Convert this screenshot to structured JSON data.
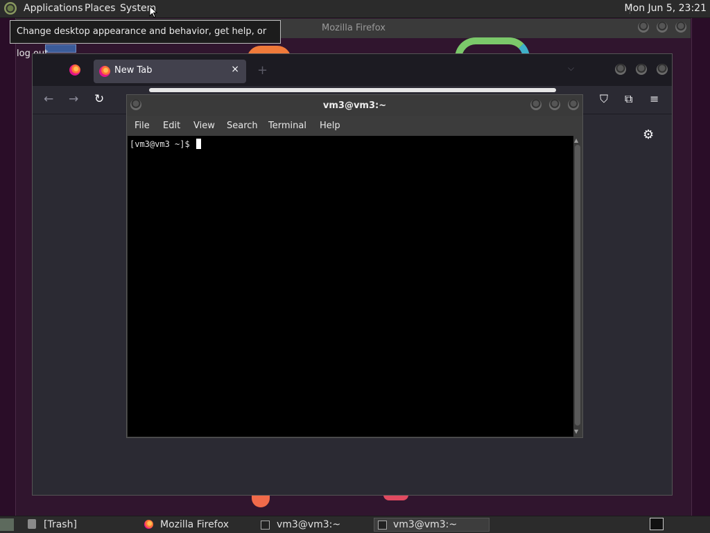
{
  "top_panel": {
    "menus": [
      "Applications",
      "Places",
      "System"
    ],
    "clock": "Mon Jun  5, 23:21"
  },
  "tooltip": "Change desktop appearance and behavior, get help, or log out",
  "background_window": {
    "title": "Mozilla Firefox"
  },
  "firefox": {
    "tab_label": "New Tab",
    "close_glyph": "×",
    "newtab_glyph": "+",
    "listall_glyph": "⌵",
    "back_glyph": "←",
    "forward_glyph": "→",
    "reload_glyph": "↻",
    "pocket_glyph": "⛉",
    "extensions_glyph": "⧉",
    "menu_glyph": "≡",
    "settings_glyph": "⚙"
  },
  "terminal": {
    "title": "vm3@vm3:~",
    "menu": [
      "File",
      "Edit",
      "View",
      "Search",
      "Terminal",
      "Help"
    ],
    "prompt": "[vm3@vm3 ~]$ "
  },
  "taskbar": {
    "items": [
      "[Trash]",
      "Mozilla Firefox",
      "vm3@vm3:~",
      "vm3@vm3:~"
    ]
  }
}
